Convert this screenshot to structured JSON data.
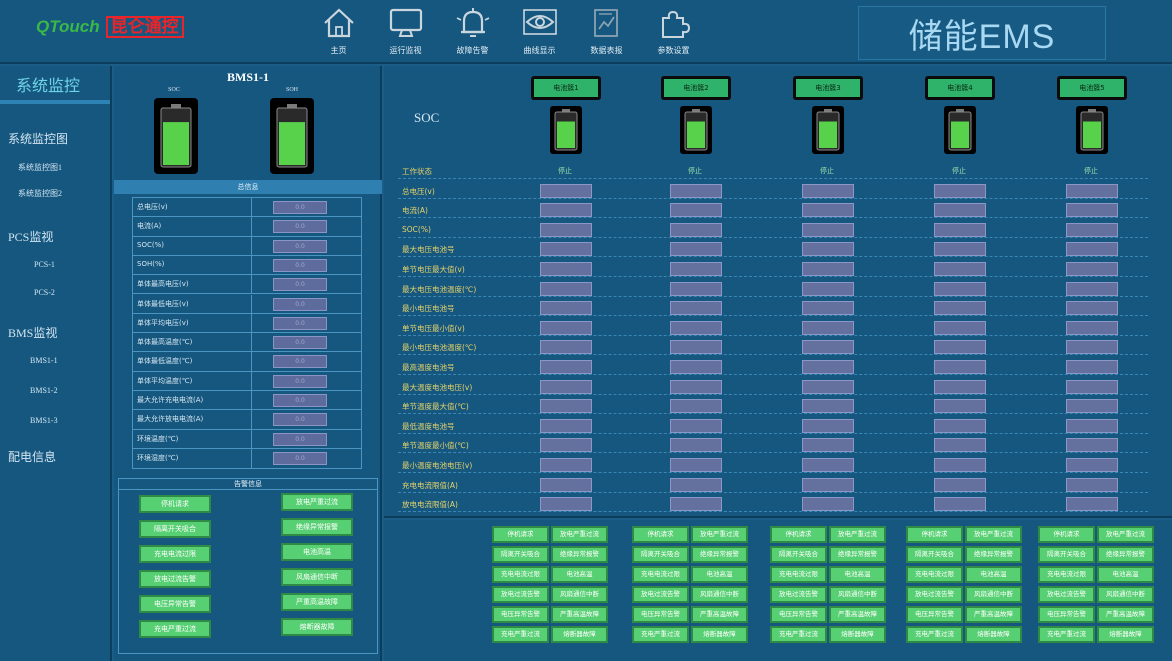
{
  "header": {
    "logo_brand": "QTouch",
    "logo_cn": "昆仑通控",
    "app_title": "储能EMS",
    "nav": [
      {
        "label": "主页",
        "icon": "home-icon"
      },
      {
        "label": "运行监视",
        "icon": "monitor-icon"
      },
      {
        "label": "故障告警",
        "icon": "alarm-bell-icon"
      },
      {
        "label": "曲线显示",
        "icon": "eye-icon"
      },
      {
        "label": "数据表报",
        "icon": "data-report-icon"
      },
      {
        "label": "参数设置",
        "icon": "puzzle-settings-icon"
      }
    ]
  },
  "sidebar": {
    "title": "系统监控",
    "groups": [
      {
        "label": "系统监控图",
        "items": [
          "系统监控图1",
          "系统监控图2"
        ]
      },
      {
        "label": "PCS监视",
        "items": [
          "PCS-1",
          "PCS-2"
        ]
      },
      {
        "label": "BMS监视",
        "items": [
          "BMS1-1",
          "BMS1-2",
          "BMS1-3"
        ]
      },
      {
        "label": "配电信息",
        "items": []
      }
    ]
  },
  "bms": {
    "title": "BMS1-1",
    "gauges": [
      {
        "label": "SOC",
        "level": 0.78
      },
      {
        "label": "SOH",
        "level": 0.78
      }
    ],
    "section_title": "总信息",
    "params": [
      {
        "label": "总电压(v)",
        "value": "0.0"
      },
      {
        "label": "电流(A)",
        "value": "0.0"
      },
      {
        "label": "SOC(%)",
        "value": "0.0"
      },
      {
        "label": "SOH(%)",
        "value": "0.0"
      },
      {
        "label": "单体最高电压(v)",
        "value": "0.0"
      },
      {
        "label": "单体最低电压(v)",
        "value": "0.0"
      },
      {
        "label": "单体平均电压(v)",
        "value": "0.0"
      },
      {
        "label": "单体最高温度(℃)",
        "value": "0.0"
      },
      {
        "label": "单体最低温度(℃)",
        "value": "0.0"
      },
      {
        "label": "单体平均温度(℃)",
        "value": "0.0"
      },
      {
        "label": "最大允许充电电流(A)",
        "value": "0.0"
      },
      {
        "label": "最大允许放电电流(A)",
        "value": "0.0"
      },
      {
        "label": "环境温度(℃)",
        "value": "0.0"
      },
      {
        "label": "环境湿度(℃)",
        "value": "0.0"
      }
    ],
    "alarm_title": "告警信息",
    "alarms_left": [
      "停机请求",
      "隔离开关吸合",
      "充电电流过限",
      "放电过流告警",
      "电压异常告警",
      "充电严重过流"
    ],
    "alarms_right": [
      "放电严重过流",
      "绝缘异常报警",
      "电池高温",
      "风扇通信中断",
      "严重高温故障",
      "熔断器故障"
    ]
  },
  "clusters": {
    "soc_label": "SOC",
    "names": [
      "电池簇1",
      "电池簇2",
      "电池簇3",
      "电池簇4",
      "电池簇5"
    ],
    "gauge_levels": [
      0.78,
      0.78,
      0.78,
      0.78,
      0.78
    ],
    "status": [
      "停止",
      "停止",
      "停止",
      "停止",
      "停止"
    ],
    "rows": [
      "工作状态",
      "总电压(v)",
      "电流(A)",
      "SOC(%)",
      "最大电压电池号",
      "单节电压最大值(v)",
      "最大电压电池温度(℃)",
      "最小电压电池号",
      "单节电压最小值(v)",
      "最小电压电池温度(℃)",
      "最高温度电池号",
      "最大温度电池电压(v)",
      "单节温度最大值(℃)",
      "最低温度电池号",
      "单节温度最小值(℃)",
      "最小温度电池电压(v)",
      "充电电流限值(A)",
      "放电电流限值(A)"
    ]
  },
  "cluster_alarms": {
    "left": [
      "停机请求",
      "隔离开关吸合",
      "充电电流过限",
      "放电过流告警",
      "电压异常告警",
      "充电严重过流"
    ],
    "right": [
      "放电严重过流",
      "绝缘异常报警",
      "电池高温",
      "风扇通信中断",
      "严重高温故障",
      "熔断器故障"
    ]
  },
  "colors": {
    "background": "#1a5d86",
    "panel": "#16577f",
    "alarm_green": "#57cf73",
    "value_cell": "#64709e",
    "row_label": "#e7d46a",
    "title_cyan": "#a8d8f2"
  }
}
